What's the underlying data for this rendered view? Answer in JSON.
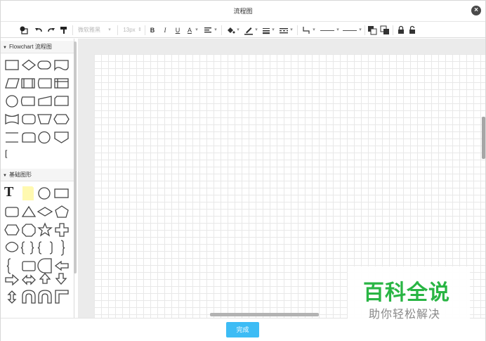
{
  "dialog": {
    "title": "流程图",
    "close_icon": "close-icon"
  },
  "toolbar": {
    "font_family": "微软雅黑",
    "font_size": "13px",
    "bold": "B",
    "italic": "I",
    "underline": "U",
    "font_color": "A"
  },
  "sidebar": {
    "sections": [
      {
        "label": "Flowchart 流程图"
      },
      {
        "label": "基础图形"
      }
    ],
    "text_shape_label": "T",
    "brace_label": "["
  },
  "footer": {
    "done_label": "完成"
  },
  "watermark": {
    "line1": "百科全说",
    "line2": "助你轻松解决"
  },
  "colors": {
    "accent": "#3dbcf5",
    "watermark_green": "#29b544"
  }
}
